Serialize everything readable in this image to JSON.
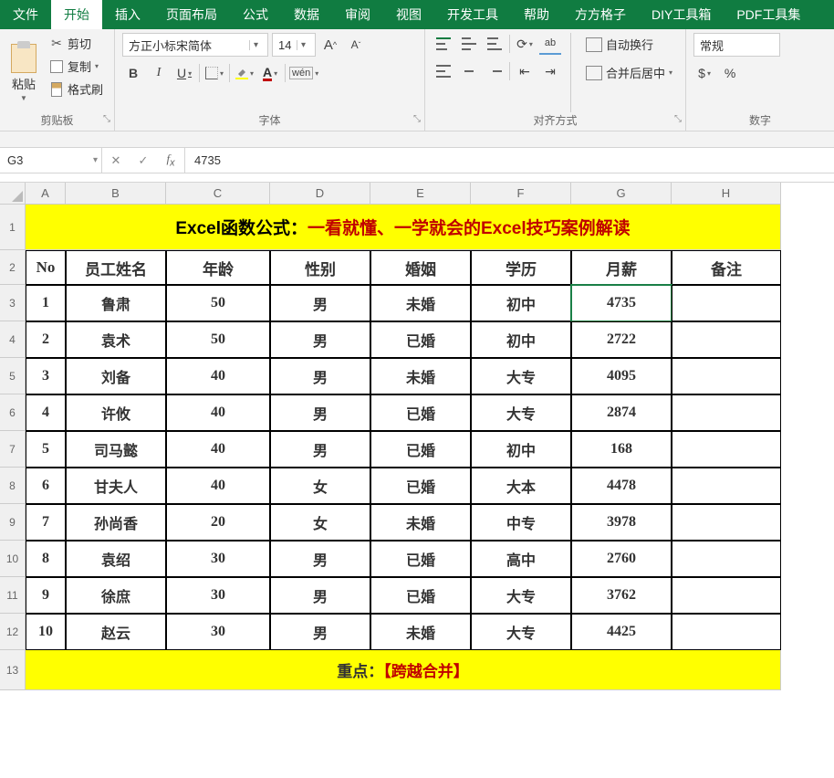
{
  "menu": {
    "items": [
      "文件",
      "开始",
      "插入",
      "页面布局",
      "公式",
      "数据",
      "审阅",
      "视图",
      "开发工具",
      "帮助",
      "方方格子",
      "DIY工具箱",
      "PDF工具集"
    ],
    "active": 1
  },
  "ribbon": {
    "clipboard": {
      "paste": "粘贴",
      "cut": "剪切",
      "copy": "复制",
      "format": "格式刷",
      "group": "剪贴板"
    },
    "font": {
      "name": "方正小标宋简体",
      "size": "14",
      "group": "字体",
      "increase": "A",
      "decrease": "A",
      "bold": "B",
      "italic": "I",
      "underline": "U",
      "fontcolor": "A",
      "pinyin": "wén"
    },
    "align": {
      "ab": "ab",
      "orient": "⟲",
      "wrap": "自动换行",
      "merge": "合并后居中",
      "group": "对齐方式"
    },
    "number": {
      "format": "常规",
      "percent": "%",
      "group": "数字",
      "currency": "$"
    }
  },
  "namebox": "G3",
  "formula": "4735",
  "cols": [
    "A",
    "B",
    "C",
    "D",
    "E",
    "F",
    "G",
    "H"
  ],
  "rows": [
    "1",
    "2",
    "3",
    "4",
    "5",
    "6",
    "7",
    "8",
    "9",
    "10",
    "11",
    "12",
    "13"
  ],
  "title": {
    "black": "Excel函数公式：",
    "red": "一看就懂、一学就会的Excel技巧案例解读"
  },
  "headers": [
    "No",
    "员工姓名",
    "年龄",
    "性别",
    "婚姻",
    "学历",
    "月薪",
    "备注"
  ],
  "data": [
    [
      "1",
      "鲁肃",
      "50",
      "男",
      "未婚",
      "初中",
      "4735",
      ""
    ],
    [
      "2",
      "袁术",
      "50",
      "男",
      "已婚",
      "初中",
      "2722",
      ""
    ],
    [
      "3",
      "刘备",
      "40",
      "男",
      "未婚",
      "大专",
      "4095",
      ""
    ],
    [
      "4",
      "许攸",
      "40",
      "男",
      "已婚",
      "大专",
      "2874",
      ""
    ],
    [
      "5",
      "司马懿",
      "40",
      "男",
      "已婚",
      "初中",
      "168",
      ""
    ],
    [
      "6",
      "甘夫人",
      "40",
      "女",
      "已婚",
      "大本",
      "4478",
      ""
    ],
    [
      "7",
      "孙尚香",
      "20",
      "女",
      "未婚",
      "中专",
      "3978",
      ""
    ],
    [
      "8",
      "袁绍",
      "30",
      "男",
      "已婚",
      "高中",
      "2760",
      ""
    ],
    [
      "9",
      "徐庶",
      "30",
      "男",
      "已婚",
      "大专",
      "3762",
      ""
    ],
    [
      "10",
      "赵云",
      "30",
      "男",
      "未婚",
      "大专",
      "4425",
      ""
    ]
  ],
  "footer": {
    "label": "重点：",
    "red": "【跨越合并】"
  },
  "active_cell": {
    "row": 3,
    "col": "G"
  }
}
